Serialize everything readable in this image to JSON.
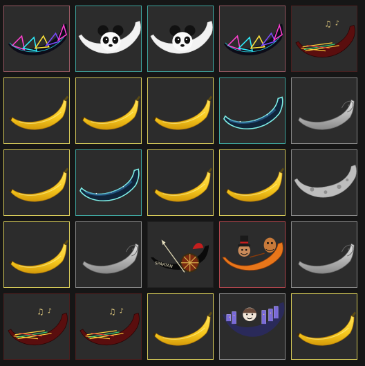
{
  "grid": {
    "rows": [
      [
        {
          "skin": "neon-banana",
          "border": "#9a5a64"
        },
        {
          "skin": "panda-banana",
          "border": "#3fa7a0"
        },
        {
          "skin": "panda-banana",
          "border": "#3fa7a0"
        },
        {
          "skin": "neon-banana",
          "border": "#9a5a64"
        },
        {
          "skin": "music-banana",
          "border": "#4a1f1f"
        }
      ],
      [
        {
          "skin": "classic-banana",
          "border": "#d8cc5a"
        },
        {
          "skin": "classic-banana",
          "border": "#d8cc5a"
        },
        {
          "skin": "classic-banana",
          "border": "#d8cc5a"
        },
        {
          "skin": "galaxy-banana",
          "border": "#3fa7a0"
        },
        {
          "skin": "statue-banana",
          "border": "#8a8a8a"
        }
      ],
      [
        {
          "skin": "classic-banana",
          "border": "#d8cc5a"
        },
        {
          "skin": "galaxy-banana",
          "border": "#3fa7a0"
        },
        {
          "skin": "classic-banana",
          "border": "#d8cc5a"
        },
        {
          "skin": "classic-banana",
          "border": "#d8cc5a"
        },
        {
          "skin": "moon-banana",
          "border": "#8a8a8a"
        }
      ],
      [
        {
          "skin": "classic-banana",
          "border": "#d8cc5a"
        },
        {
          "skin": "statue-banana",
          "border": "#8a8a8a"
        },
        {
          "skin": "spartan-banana",
          "border": "#222222"
        },
        {
          "skin": "circus-banana",
          "border": "#b0474e"
        },
        {
          "skin": "statue-banana",
          "border": "#8a8a8a"
        }
      ],
      [
        {
          "skin": "music-banana",
          "border": "#4a1f1f"
        },
        {
          "skin": "music-banana",
          "border": "#4a1f1f"
        },
        {
          "skin": "classic-banana",
          "border": "#d8cc5a"
        },
        {
          "skin": "city-banana",
          "border": "#8a8a8a"
        },
        {
          "skin": "classic-banana",
          "border": "#d8cc5a"
        }
      ]
    ],
    "spartan_text": "SPARTAN"
  }
}
